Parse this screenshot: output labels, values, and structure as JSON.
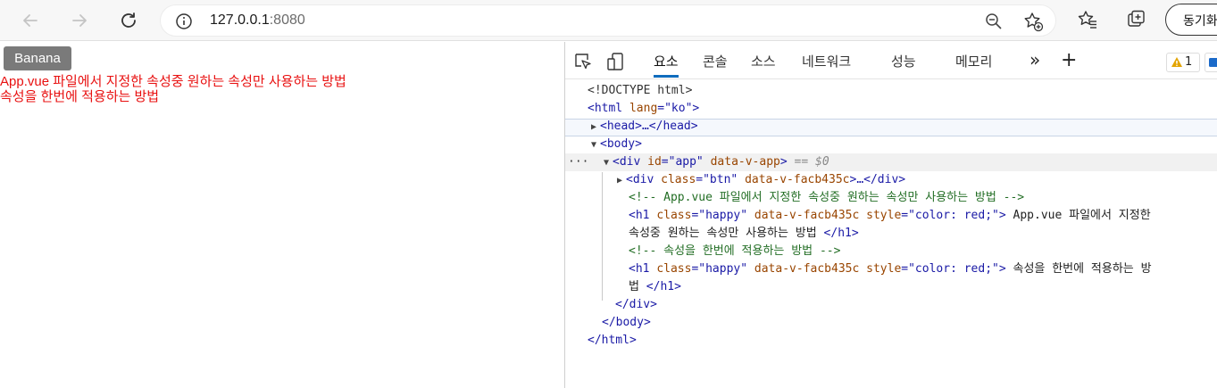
{
  "browser": {
    "url_host": "127.0.0.1",
    "url_port": ":8080",
    "sync_label": "동기화"
  },
  "page": {
    "button_label": "Banana",
    "line1": "App.vue 파일에서 지정한 속성중 원하는 속성만 사용하는 방법",
    "line2": "속성을 한번에 적용하는 방법"
  },
  "devtools": {
    "tabs": [
      "요소",
      "콘솔",
      "소스",
      "네트워크",
      "성능",
      "메모리"
    ],
    "active_tab": "요소",
    "warning_count": "1",
    "code": {
      "doctype": "<!DOCTYPE html>",
      "html_open": "<html",
      "html_lang_attr": "lang",
      "html_lang_val": "\"ko\"",
      "gt": ">",
      "head": "<head>…</head>",
      "body_open": "<body>",
      "div_open": "<div",
      "id_attr": "id",
      "id_val": "\"app\"",
      "data_v_app": "data-v-app",
      "eq_dollar": "== $0",
      "div_btn_class": "class",
      "div_btn_val": "\"btn\"",
      "data_v_facb": "data-v-facb435c",
      "ellipsis_close": "…</div>",
      "comment1": "<!-- App.vue 파일에서 지정한 속성중 원하는 속성만 사용하는 방법 -->",
      "h1_open": "<h1",
      "class_attr": "class",
      "happy_val": "\"happy\"",
      "style_attr": "style",
      "style_val": "\"color: red;\"",
      "h1_text1a": " App.vue 파일에서 지정한",
      "h1_text1b": "속성중 원하는 속성만 사용하는 방법 ",
      "h1_close": "</h1>",
      "comment2": "<!-- 속성을 한번에 적용하는 방법 -->",
      "h1_text2a": " 속성을 한번에 적용하는 방",
      "h1_text2b": "법 ",
      "div_close": "</div>",
      "body_close": "</body>",
      "html_close": "</html>",
      "dots": "···"
    }
  }
}
